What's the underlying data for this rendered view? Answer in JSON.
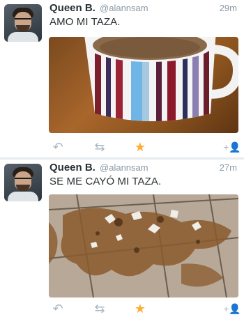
{
  "tweets": [
    {
      "name": "Queen B.",
      "handle": "@alannsam",
      "time": "29m",
      "text": "AMO MI TAZA."
    },
    {
      "name": "Queen B.",
      "handle": "@alannsam",
      "time": "27m",
      "text": "SE ME CAYÓ MI TAZA."
    }
  ],
  "icons": {
    "reply": "reply-icon",
    "retweet": "retweet-icon",
    "favorite": "star-icon",
    "follow": "add-user-icon"
  },
  "colors": {
    "text": "#292f33",
    "muted": "#8899a6",
    "icon": "#aab8c2",
    "favorite": "#ffac33"
  }
}
